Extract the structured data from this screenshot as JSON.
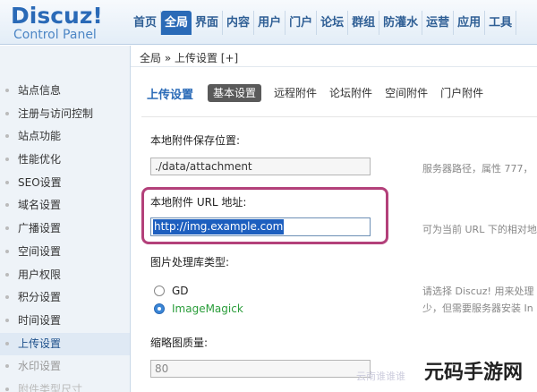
{
  "logo": {
    "title": "Discuz!",
    "subtitle": "Control Panel"
  },
  "topnav": [
    "首页",
    "全局",
    "界面",
    "内容",
    "用户",
    "门户",
    "论坛",
    "群组",
    "防灌水",
    "运营",
    "应用",
    "工具"
  ],
  "topnav_active_index": 1,
  "breadcrumb": "全局 » 上传设置 [+]",
  "sidebar": {
    "items": [
      "站点信息",
      "注册与访问控制",
      "站点功能",
      "性能优化",
      "SEO设置",
      "域名设置",
      "广播设置",
      "空间设置",
      "用户权限",
      "积分设置",
      "时间设置",
      "上传设置",
      "水印设置",
      "附件类型尺寸"
    ],
    "active_index": 11
  },
  "tabs": {
    "title": "上传设置",
    "items": [
      "基本设置",
      "远程附件",
      "论坛附件",
      "空间附件",
      "门户附件"
    ],
    "active_index": 0
  },
  "form": {
    "storage": {
      "label": "本地附件保存位置:",
      "value": "./data/attachment",
      "hint": "服务器路径，属性 777，"
    },
    "url": {
      "label": "本地附件 URL 地址:",
      "value": "http://img.example.com",
      "hint": "可为当前 URL 下的相对地"
    },
    "image_lib": {
      "label": "图片处理库类型:",
      "options": [
        "GD",
        "ImageMagick"
      ],
      "selected_index": 1,
      "hint_line1": "请选择 Discuz! 用来处理",
      "hint_line2": "少，但需要服务器安装 In"
    },
    "thumb_quality": {
      "label": "缩略图质量:",
      "value": "80"
    }
  },
  "watermark": {
    "text": "元码手游网",
    "faint": "云南谁谁谁"
  },
  "colors": {
    "accent": "#2a6ab7",
    "highlight_border": "#b3407a",
    "selected_option": "#2a9d3a"
  }
}
